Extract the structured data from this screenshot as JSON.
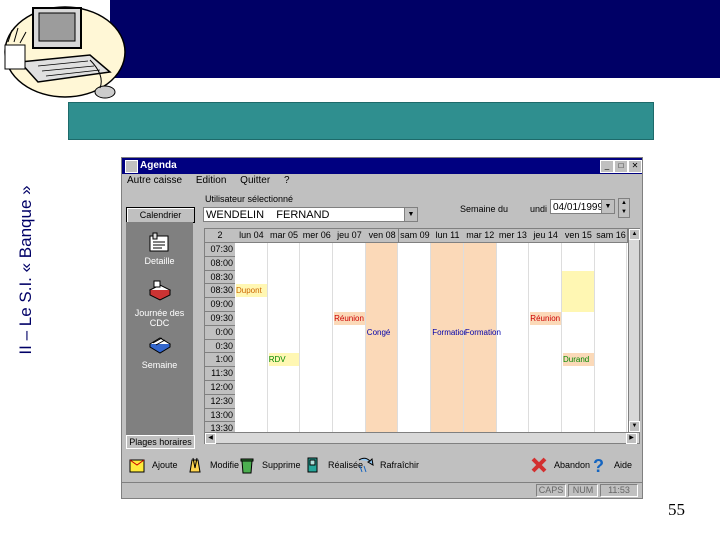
{
  "slide": {
    "side_text": "II – Le S.I. « Banque »",
    "page_number": "55"
  },
  "window": {
    "title": "Agenda",
    "menu": [
      "Autre caisse",
      "Edition",
      "Quitter",
      "?"
    ],
    "calendar_button": "Calendrier",
    "user_label": "Utilisateur sélectionné",
    "user_value": "WENDELIN    FERNAND",
    "week_label": "Semaine du",
    "day_label": "undi",
    "date_value": "04/01/1999",
    "left_items": [
      {
        "icon": "detail-icon",
        "label": "Detaille"
      },
      {
        "icon": "cdc-icon",
        "label": "Journée des CDC"
      },
      {
        "icon": "week-icon",
        "label": "Semaine"
      }
    ],
    "places_button": "Plages horaires",
    "grid": {
      "corner": "2",
      "columns": [
        "lun 04",
        "mar 05",
        "mer 06",
        "jeu 07",
        "ven 08",
        "sam 09",
        "lun 11",
        "mar 12",
        "mer 13",
        "jeu 14",
        "ven 15",
        "sam 16"
      ],
      "times": [
        "07:30",
        "08:00",
        "08:30",
        "08:30",
        "09:00",
        "09:30",
        "0:00",
        "0:30",
        "1:00",
        "11:30",
        "12:00",
        "12:30",
        "13:00",
        "13:30"
      ],
      "events": [
        {
          "label": "Dupont",
          "col": 0,
          "row": 3,
          "color": "#cc6600",
          "bg": "#fff7b3"
        },
        {
          "label": "Réunion",
          "col": 3,
          "row": 5,
          "color": "#cc0000",
          "bg": "#fbd9b8"
        },
        {
          "label": "Congé",
          "col": 4,
          "row": 6,
          "color": "#0000aa",
          "bg": "#fbd9b8"
        },
        {
          "label": "Formation",
          "col": 6,
          "row": 6,
          "color": "#0000aa",
          "bg": "#fbd9b8"
        },
        {
          "label": "Formation",
          "col": 7,
          "row": 6,
          "color": "#0000aa",
          "bg": "#fbd9b8"
        },
        {
          "label": "Réunion",
          "col": 9,
          "row": 5,
          "color": "#cc0000",
          "bg": "#fbd9b8"
        },
        {
          "label": "RDV",
          "col": 1,
          "row": 8,
          "color": "#008800",
          "bg": "#fff7b3"
        },
        {
          "label": "Durand",
          "col": 10,
          "row": 8,
          "color": "#008800",
          "bg": "#fbd9b8"
        }
      ]
    },
    "toolbar": [
      {
        "icon": "add-icon",
        "label": "Ajoute"
      },
      {
        "icon": "edit-pencil-icon",
        "label": "Modifie"
      },
      {
        "icon": "trash-icon",
        "label": "Supprime"
      },
      {
        "icon": "realize-icon",
        "label": "Réalisée"
      },
      {
        "icon": "refresh-icon",
        "label": "Rafraîchir"
      },
      {
        "icon": "abandon-icon",
        "label": "Abandon"
      },
      {
        "icon": "help-icon",
        "label": "Aide"
      }
    ],
    "status": [
      "CAPS",
      "NUM",
      "11:53"
    ]
  }
}
